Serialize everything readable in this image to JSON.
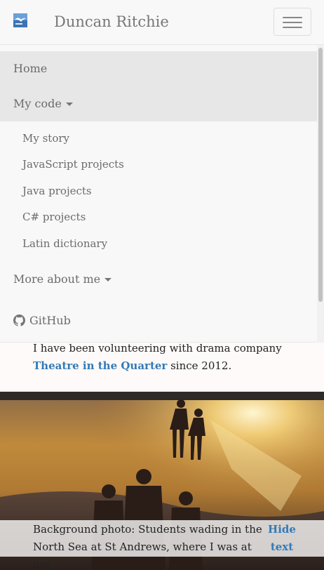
{
  "header": {
    "brand": "Duncan Ritchie",
    "logo_icon": "seagull-logo-icon",
    "menu_toggle_icon": "hamburger-icon"
  },
  "menu": {
    "home": "Home",
    "my_code": "My code",
    "code_items": [
      "My story",
      "JavaScript projects",
      "Java projects",
      "C# projects",
      "Latin dictionary"
    ],
    "more_about": "More about me",
    "github": "GitHub"
  },
  "content": {
    "text_before": "I have been volunteering with drama company ",
    "link": "Theatre in the Quarter",
    "text_after": " since 2012."
  },
  "caption": {
    "text": "Background photo: Students wading in the North Sea at St Andrews, where I was at uni.",
    "hide": "Hide text"
  },
  "colors": {
    "link": "#337ab7",
    "navbar_bg": "#f8f8f8",
    "active_bg": "#e7e7e7",
    "nav_text": "#777777"
  }
}
